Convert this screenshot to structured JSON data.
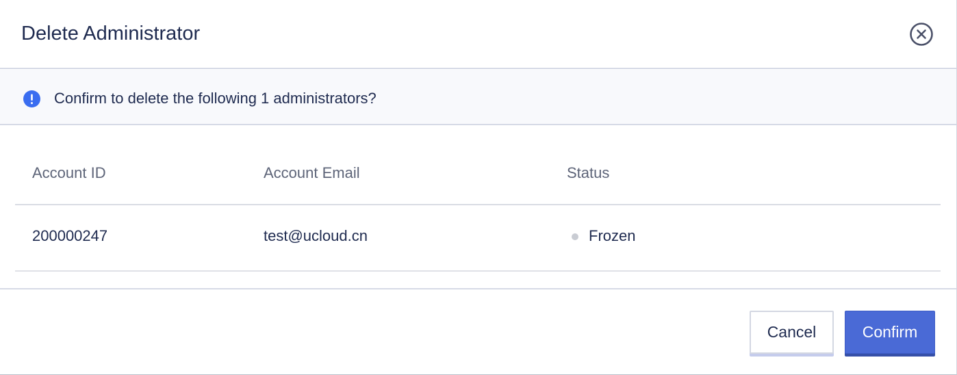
{
  "dialog": {
    "title": "Delete Administrator",
    "close_icon": "close-circle-icon"
  },
  "alert": {
    "icon": "info-exclamation-icon",
    "message": "Confirm to delete the following 1 administrators?",
    "icon_color": "#3a6df0"
  },
  "table": {
    "headers": [
      "Account ID",
      "Account Email",
      "Status"
    ],
    "rows": [
      {
        "account_id": "200000247",
        "account_email": "test@ucloud.cn",
        "status": "Frozen",
        "status_color": "#c9ccd3"
      }
    ]
  },
  "footer": {
    "cancel_label": "Cancel",
    "confirm_label": "Confirm"
  },
  "colors": {
    "primary": "#4a6ad6",
    "text": "#1e2a4f"
  }
}
